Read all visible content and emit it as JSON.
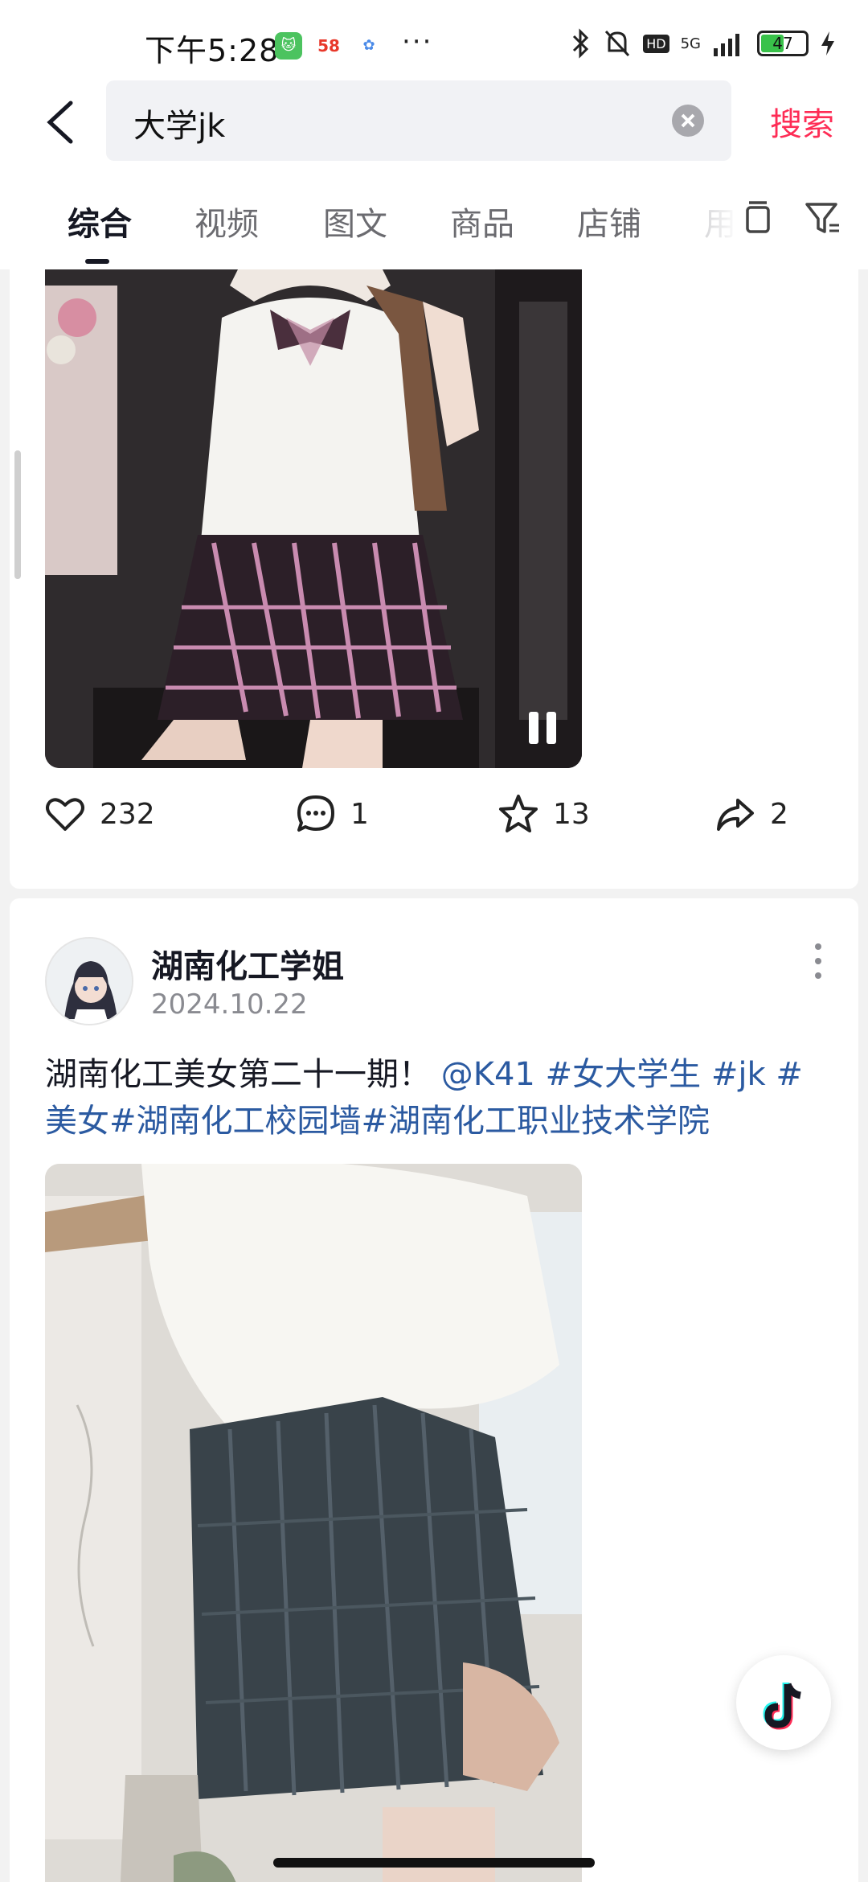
{
  "status_bar": {
    "time": "下午5:28",
    "apps": [
      "cat-app-icon",
      "58-app-icon",
      "flower-app-icon"
    ],
    "overflow": "···",
    "network": "5G",
    "hd": "HD",
    "battery": "47"
  },
  "search": {
    "query": "大学jk",
    "submit_label": "搜索"
  },
  "tabs": [
    {
      "label": "综合",
      "active": true
    },
    {
      "label": "视频",
      "active": false
    },
    {
      "label": "图文",
      "active": false
    },
    {
      "label": "商品",
      "active": false
    },
    {
      "label": "店铺",
      "active": false
    },
    {
      "label": "用",
      "active": false
    }
  ],
  "post1": {
    "stats": {
      "likes": "232",
      "comments": "1",
      "favorites": "13",
      "shares": "2"
    }
  },
  "post2": {
    "author": "湖南化工学姐",
    "date": "2024.10.22",
    "caption_text": "湖南化工美女第二十一期！",
    "mentions": [
      "@K41",
      "#女大学生",
      "#jk",
      "#美女",
      "#湖南化工校园墙",
      "#湖南化工职业技术学院"
    ]
  },
  "colors": {
    "accent": "#fe2c55",
    "link": "#2b5aa1"
  }
}
